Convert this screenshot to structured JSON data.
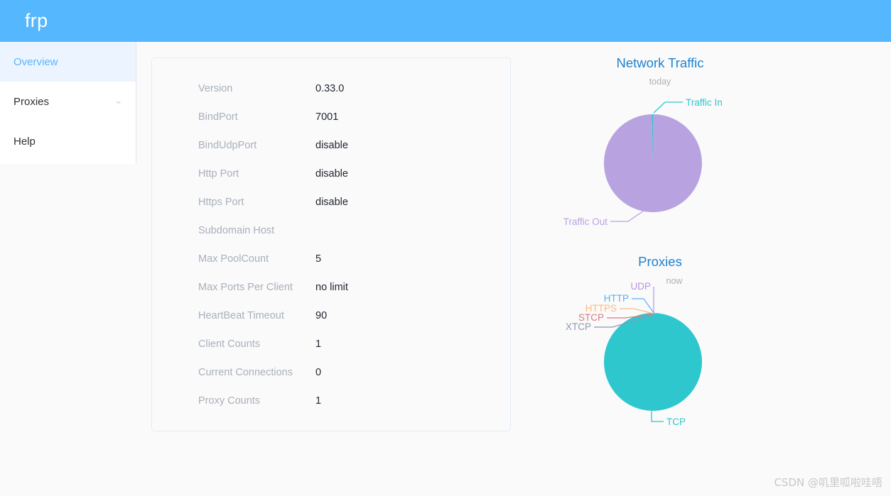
{
  "header": {
    "brand": "frp"
  },
  "sidebar": {
    "items": [
      {
        "label": "Overview",
        "active": true,
        "chevron": ""
      },
      {
        "label": "Proxies",
        "active": false,
        "chevron": "⌄"
      },
      {
        "label": "Help",
        "active": false,
        "chevron": ""
      }
    ]
  },
  "info": {
    "rows": [
      {
        "label": "Version",
        "value": "0.33.0"
      },
      {
        "label": "BindPort",
        "value": "7001"
      },
      {
        "label": "BindUdpPort",
        "value": "disable"
      },
      {
        "label": "Http Port",
        "value": "disable"
      },
      {
        "label": "Https Port",
        "value": "disable"
      },
      {
        "label": "Subdomain Host",
        "value": ""
      },
      {
        "label": "Max PoolCount",
        "value": "5"
      },
      {
        "label": "Max Ports Per Client",
        "value": "no limit"
      },
      {
        "label": "HeartBeat Timeout",
        "value": "90"
      },
      {
        "label": "Client Counts",
        "value": "1"
      },
      {
        "label": "Current Connections",
        "value": "0"
      },
      {
        "label": "Proxy Counts",
        "value": "1"
      }
    ]
  },
  "charts": {
    "network_traffic": {
      "title": "Network Traffic",
      "subtitle": "today",
      "labels": {
        "traffic_in": "Traffic In",
        "traffic_out": "Traffic Out"
      }
    },
    "proxies": {
      "title": "Proxies",
      "subtitle": "now",
      "labels": {
        "tcp": "TCP",
        "udp": "UDP",
        "http": "HTTP",
        "https": "HTTPS",
        "stcp": "STCP",
        "xtcp": "XTCP"
      }
    }
  },
  "watermark": "CSDN @叽里呱啦哇唔",
  "chart_data": [
    {
      "type": "pie",
      "title": "Network Traffic",
      "subtitle": "today",
      "legend_position": "outside-labels",
      "categories": [
        "Traffic In",
        "Traffic Out"
      ],
      "values": [
        0.5,
        99.5
      ],
      "colors": [
        "#2ec7ce",
        "#b8a3e0"
      ],
      "unit": "percent-of-total"
    },
    {
      "type": "pie",
      "title": "Proxies",
      "subtitle": "now",
      "legend_position": "outside-labels",
      "categories": [
        "TCP",
        "UDP",
        "HTTP",
        "HTTPS",
        "STCP",
        "XTCP"
      ],
      "values": [
        1,
        0,
        0,
        0,
        0,
        0
      ],
      "colors": [
        "#2ec7ce",
        "#b395e0",
        "#5ab1ef",
        "#ffb980",
        "#d87a80",
        "#8d98b3"
      ],
      "unit": "count"
    }
  ]
}
